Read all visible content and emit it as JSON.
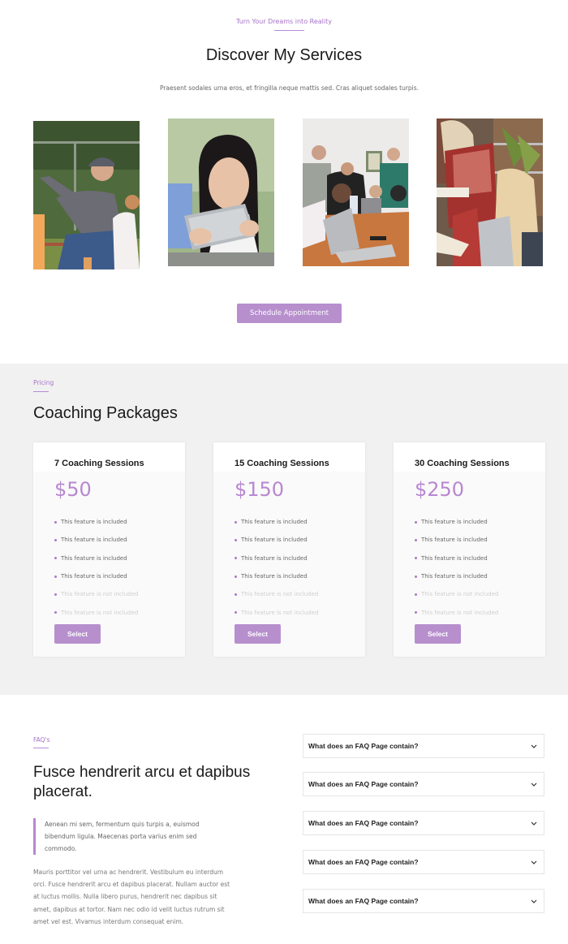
{
  "services": {
    "eyebrow": "Turn Your Dreams into Reality",
    "title": "Discover My Services",
    "subtitle": "Praesent sodales urna eros, et fringilla neque mattis sed. Cras aliquet sodales turpis.",
    "photos": [
      {
        "alt": "Coach in cap gesturing to young players on a sports field"
      },
      {
        "alt": "Smiling young woman using a tablet"
      },
      {
        "alt": "Group of young people around a table with laptops"
      },
      {
        "alt": "Two women in plaid shirts reading in a library"
      }
    ],
    "cta_label": "Schedule Appointment"
  },
  "pricing": {
    "eyebrow": "Pricing",
    "title": "Coaching Packages",
    "packages": [
      {
        "name": "7 Coaching Sessions",
        "price": "$50",
        "features": [
          {
            "label": "This feature is included",
            "included": true
          },
          {
            "label": "This feature is included",
            "included": true
          },
          {
            "label": "This feature is included",
            "included": true
          },
          {
            "label": "This feature is included",
            "included": true
          },
          {
            "label": "This feature is not included",
            "included": false
          },
          {
            "label": "This feature is not included",
            "included": false
          }
        ],
        "button_label": "Select"
      },
      {
        "name": "15 Coaching Sessions",
        "price": "$150",
        "features": [
          {
            "label": "This feature is included",
            "included": true
          },
          {
            "label": "This feature is included",
            "included": true
          },
          {
            "label": "This feature is included",
            "included": true
          },
          {
            "label": "This feature is included",
            "included": true
          },
          {
            "label": "This feature is not included",
            "included": false
          },
          {
            "label": "This feature is not included",
            "included": false
          }
        ],
        "button_label": "Select"
      },
      {
        "name": "30 Coaching Sessions",
        "price": "$250",
        "features": [
          {
            "label": "This feature is included",
            "included": true
          },
          {
            "label": "This feature is included",
            "included": true
          },
          {
            "label": "This feature is included",
            "included": true
          },
          {
            "label": "This feature is included",
            "included": true
          },
          {
            "label": "This feature is not included",
            "included": false
          },
          {
            "label": "This feature is not included",
            "included": false
          }
        ],
        "button_label": "Select"
      }
    ]
  },
  "faq": {
    "eyebrow": "FAQ's",
    "title": "Fusce hendrerit arcu et dapibus placerat.",
    "quote": "Aenean mi sem, fermentum quis turpis a, euismod bibendum ligula. Maecenas porta varius enim sed commodo.",
    "body": "Mauris porttitor vel urna ac hendrerit. Vestibulum eu interdum orci. Fusce hendrerit arcu et dapibus placerat. Nullam auctor est at luctus mollis. Nulla libero purus, hendrerit nec dapibus sit amet, dapibus at tortor. Nam nec odio id velit luctus rutrum sit amet vel est. Vivamus interdum consequat enim.",
    "questions": [
      {
        "question": "What does an FAQ Page contain?",
        "icon": "chevron-down-icon"
      },
      {
        "question": "What does an FAQ Page contain?",
        "icon": "chevron-down-icon"
      },
      {
        "question": "What does an FAQ Page contain?",
        "icon": "chevron-down-icon"
      },
      {
        "question": "What does an FAQ Page contain?",
        "icon": "chevron-down-icon"
      },
      {
        "question": "What does an FAQ Page contain?",
        "icon": "chevron-down-icon"
      }
    ]
  },
  "colors": {
    "accent": "#b78fcd",
    "accent_text": "#a771c9",
    "pricing_bg": "#f1f1f1"
  }
}
